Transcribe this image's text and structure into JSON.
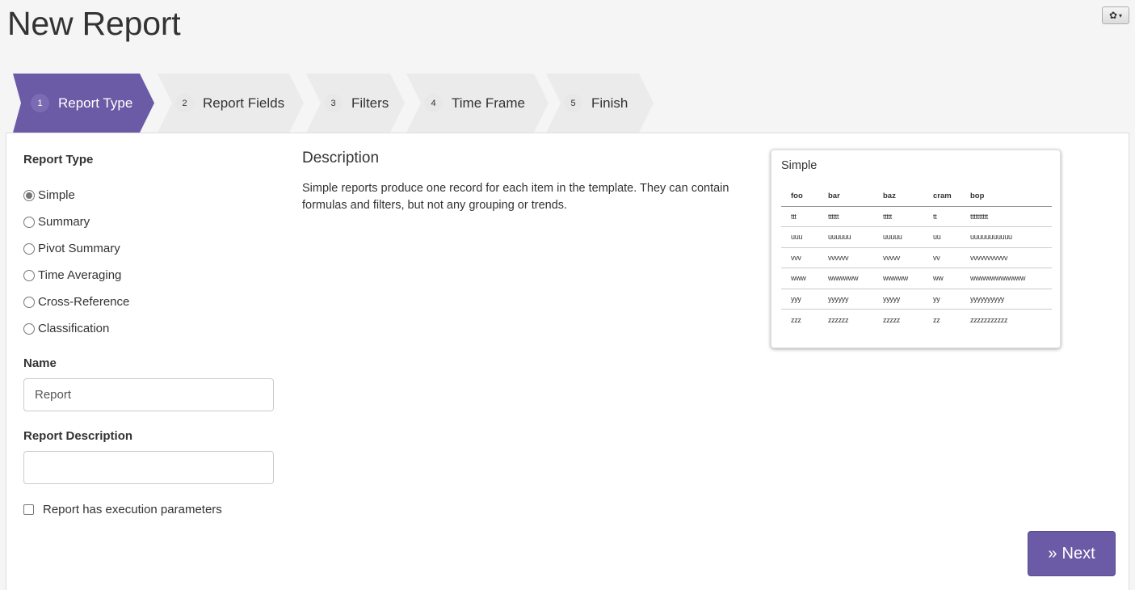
{
  "page": {
    "title": "New Report"
  },
  "toolbar": {
    "settings_icon": "gear-icon",
    "settings_caret": "▾"
  },
  "wizard": {
    "active_color": "#6b5ba6",
    "inactive_color": "#ebebeb",
    "steps": [
      {
        "num": "1",
        "label": "Report Type",
        "active": true
      },
      {
        "num": "2",
        "label": "Report Fields",
        "active": false
      },
      {
        "num": "3",
        "label": "Filters",
        "active": false
      },
      {
        "num": "4",
        "label": "Time Frame",
        "active": false
      },
      {
        "num": "5",
        "label": "Finish",
        "active": false
      }
    ]
  },
  "form": {
    "report_type_label": "Report Type",
    "options": [
      {
        "label": "Simple",
        "checked": true
      },
      {
        "label": "Summary",
        "checked": false
      },
      {
        "label": "Pivot Summary",
        "checked": false
      },
      {
        "label": "Time Averaging",
        "checked": false
      },
      {
        "label": "Cross-Reference",
        "checked": false
      },
      {
        "label": "Classification",
        "checked": false
      }
    ],
    "name_label": "Name",
    "name_value": "Report",
    "report_description_label": "Report Description",
    "report_description_value": "",
    "exec_params_label": "Report has execution parameters",
    "exec_params_checked": false
  },
  "description": {
    "heading": "Description",
    "text": "Simple reports produce one record for each item in the template. They can contain formulas and filters, but not any grouping or trends."
  },
  "preview": {
    "title": "Simple",
    "columns": [
      "foo",
      "bar",
      "baz",
      "cram",
      "bop"
    ],
    "rows": [
      [
        "ttt",
        "tttttt",
        "ttttt",
        "tt",
        "tttttttttt"
      ],
      [
        "uuu",
        "uuuuuu",
        "uuuuu",
        "uu",
        "uuuuuuuuuuu"
      ],
      [
        "vvv",
        "vvvvvv",
        "vvvvv",
        "vv",
        "vvvvvvvvvvv"
      ],
      [
        "www",
        "wwwwww",
        "wwwww",
        "ww",
        "wwwwwwwwwww"
      ],
      [
        "yyy",
        "yyyyyy",
        "yyyyy",
        "yy",
        "yyyyyyyyyy"
      ],
      [
        "zzz",
        "zzzzzz",
        "zzzzz",
        "zz",
        "zzzzzzzzzzz"
      ]
    ]
  },
  "actions": {
    "next_label": "Next",
    "next_icon": "»"
  }
}
